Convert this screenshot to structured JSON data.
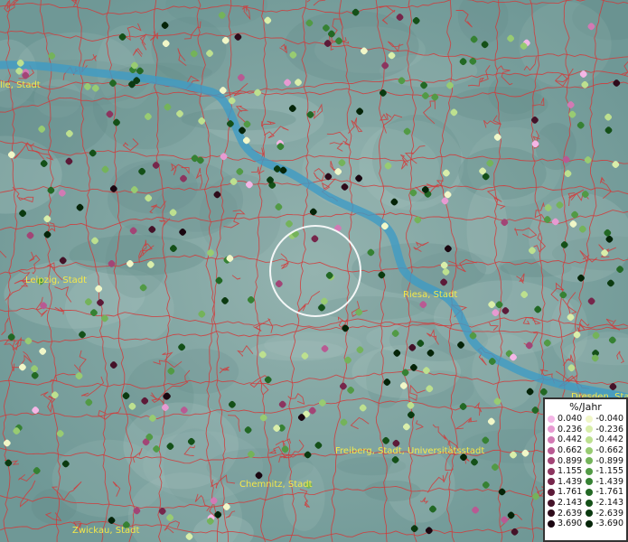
{
  "map": {
    "cities": [
      {
        "id": "halle",
        "label": "lle, Stadt"
      },
      {
        "id": "leipzig",
        "label": "Leipzig, Stadt"
      },
      {
        "id": "riesa",
        "label": "Riesa, Stadt"
      },
      {
        "id": "dresden",
        "label": "Dresden, Stadt"
      },
      {
        "id": "freiberg",
        "label": "Freiberg, Stadt, Universitätsstadt"
      },
      {
        "id": "chemnitz",
        "label": "Chemnitz, Stadt"
      },
      {
        "id": "zwickau",
        "label": "Zwickau, Stadt"
      }
    ],
    "colors": {
      "background": "#7ea3a1",
      "river": "#3f9bc4",
      "boundary": "#d23a3a",
      "label": "#f4e84a",
      "selection_ring": "#ffffff"
    }
  },
  "legend": {
    "title": "%/Jahr",
    "positive": [
      {
        "value": "0.040",
        "color": "#f4b6e6"
      },
      {
        "value": "0.236",
        "color": "#e79ad2"
      },
      {
        "value": "0.442",
        "color": "#d27ab4"
      },
      {
        "value": "0.662",
        "color": "#b85a93"
      },
      {
        "value": "0.899",
        "color": "#a24576"
      },
      {
        "value": "1.155",
        "color": "#8c355f"
      },
      {
        "value": "1.439",
        "color": "#76264b"
      },
      {
        "value": "1.761",
        "color": "#5c1a38"
      },
      {
        "value": "2.143",
        "color": "#441228"
      },
      {
        "value": "2.639",
        "color": "#2e0b1a"
      },
      {
        "value": "3.690",
        "color": "#1a0610"
      }
    ],
    "negative": [
      {
        "value": "-0.040",
        "color": "#f1f7c8"
      },
      {
        "value": "-0.236",
        "color": "#d9eeaa"
      },
      {
        "value": "-0.442",
        "color": "#bde08f"
      },
      {
        "value": "-0.662",
        "color": "#98cb72"
      },
      {
        "value": "-0.899",
        "color": "#74b35a"
      },
      {
        "value": "-1.155",
        "color": "#529a45"
      },
      {
        "value": "-1.439",
        "color": "#368133"
      },
      {
        "value": "-1.761",
        "color": "#226824"
      },
      {
        "value": "-2.143",
        "color": "#145018"
      },
      {
        "value": "-2.639",
        "color": "#0b3a10"
      },
      {
        "value": "-3.690",
        "color": "#052408"
      }
    ]
  }
}
